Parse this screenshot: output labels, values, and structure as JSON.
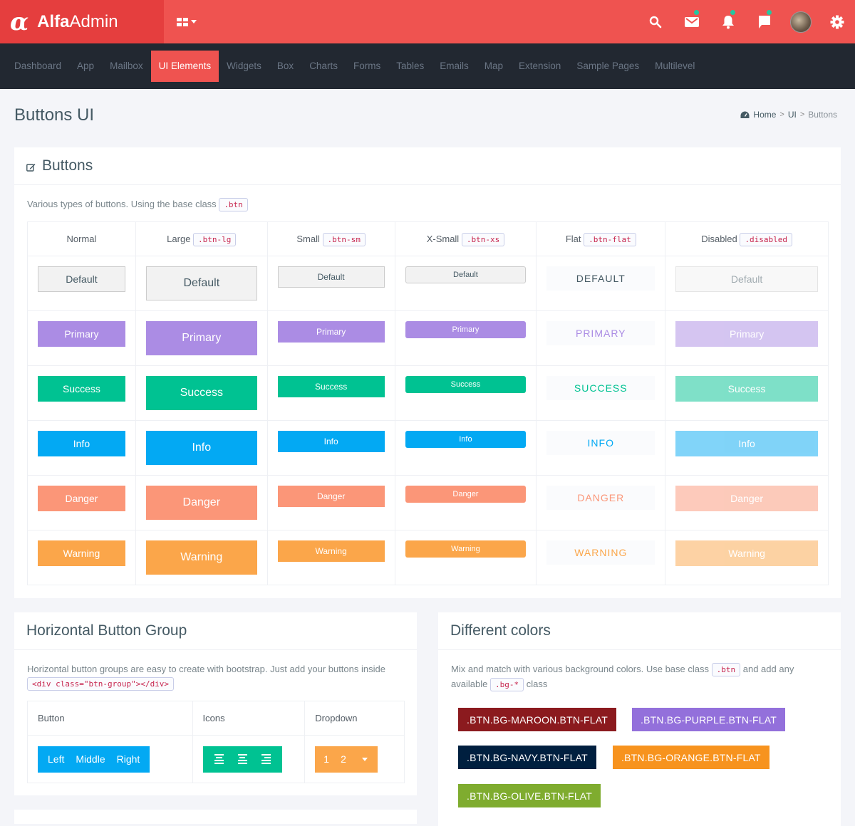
{
  "app": {
    "logo_symbol": "α",
    "name_bold": "Alfa",
    "name_light": "Admin"
  },
  "topbar": {
    "icons": [
      "apps-grid-icon",
      "search-icon",
      "mail-icon",
      "bell-icon",
      "chat-icon",
      "avatar",
      "gear-icon"
    ],
    "badge_color": "#26c6a0"
  },
  "nav": {
    "items": [
      {
        "label": "Dashboard"
      },
      {
        "label": "App"
      },
      {
        "label": "Mailbox"
      },
      {
        "label": "UI Elements",
        "active": true
      },
      {
        "label": "Widgets"
      },
      {
        "label": "Box"
      },
      {
        "label": "Charts"
      },
      {
        "label": "Forms"
      },
      {
        "label": "Tables"
      },
      {
        "label": "Emails"
      },
      {
        "label": "Map"
      },
      {
        "label": "Extension"
      },
      {
        "label": "Sample Pages"
      },
      {
        "label": "Multilevel"
      }
    ]
  },
  "page": {
    "title": "Buttons UI"
  },
  "breadcrumb": {
    "home": "Home",
    "section": "UI",
    "current": "Buttons"
  },
  "buttons_box": {
    "title": "Buttons",
    "desc": "Various types of buttons. Using the base class",
    "desc_code": ".btn",
    "columns": [
      {
        "label": "Normal",
        "code": ""
      },
      {
        "label": "Large",
        "code": ".btn-lg"
      },
      {
        "label": "Small",
        "code": ".btn-sm"
      },
      {
        "label": "X-Small",
        "code": ".btn-xs"
      },
      {
        "label": "Flat",
        "code": ".btn-flat"
      },
      {
        "label": "Disabled",
        "code": ".disabled"
      }
    ],
    "rows": [
      {
        "label": "Default",
        "flat": "DEFAULT",
        "color": "#f2f2f2"
      },
      {
        "label": "Primary",
        "flat": "PRIMARY",
        "color": "#ab8ce4"
      },
      {
        "label": "Success",
        "flat": "SUCCESS",
        "color": "#00c292"
      },
      {
        "label": "Info",
        "flat": "INFO",
        "color": "#03a9f3"
      },
      {
        "label": "Danger",
        "flat": "DANGER",
        "color": "#fb9678"
      },
      {
        "label": "Warning",
        "flat": "WARNING",
        "color": "#fba64a"
      }
    ]
  },
  "hgroup_box": {
    "title": "Horizontal Button Group",
    "desc": "Horizontal button groups are easy to create with bootstrap. Just add your buttons inside",
    "desc_code": "<div class=\"btn-group\"></div>",
    "headers": [
      "Button",
      "Icons",
      "Dropdown"
    ],
    "buttons": [
      "Left",
      "Middle",
      "Right"
    ],
    "icons": [
      "align-left-icon",
      "align-center-icon",
      "align-right-icon"
    ],
    "dropdown": [
      "1",
      "2"
    ]
  },
  "colors_box": {
    "title": "Different colors",
    "desc_1": "Mix and match with various background colors. Use base class",
    "desc_code_1": ".btn",
    "desc_2": "and add any available",
    "desc_code_2": ".bg-*",
    "desc_3": "class",
    "buttons": [
      {
        "label": ".BTN.BG-MAROON.BTN-FLAT",
        "color": "#8b1a1e"
      },
      {
        "label": ".BTN.BG-PURPLE.BTN-FLAT",
        "color": "#9370db"
      },
      {
        "label": ".BTN.BG-NAVY.BTN-FLAT",
        "color": "#001f3f"
      },
      {
        "label": ".BTN.BG-ORANGE.BTN-FLAT",
        "color": "#f7931e"
      },
      {
        "label": ".BTN.BG-OLIVE.BTN-FLAT",
        "color": "#7fac2f"
      }
    ]
  }
}
